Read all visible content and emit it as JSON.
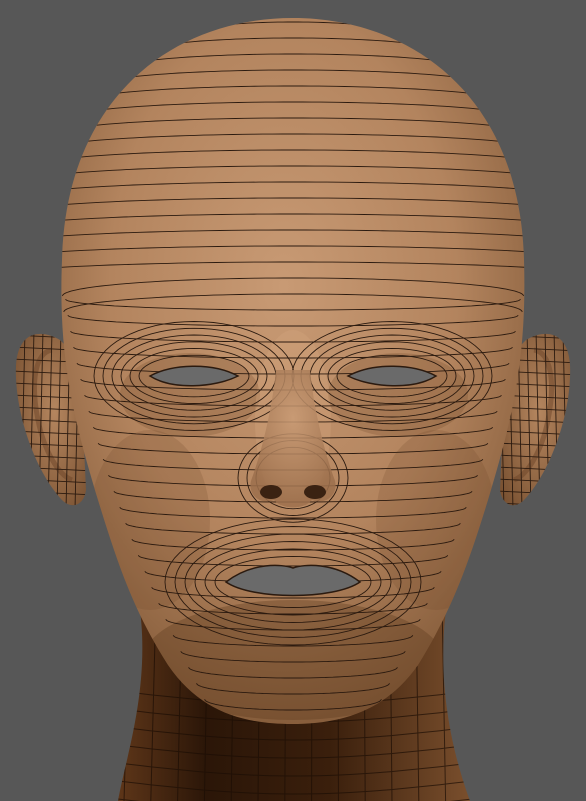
{
  "viewport": {
    "background_color": "#575757",
    "shading": "clay",
    "wireframe_overlay": true
  },
  "model": {
    "subject": "head",
    "view": "front",
    "skin_light": "#c59670",
    "skin_mid": "#a77954",
    "skin_dark": "#5a3218",
    "neck_shadow": "#2a1608",
    "opening_color": "#6a6a6a",
    "wire_color": "#2b1a0f"
  }
}
